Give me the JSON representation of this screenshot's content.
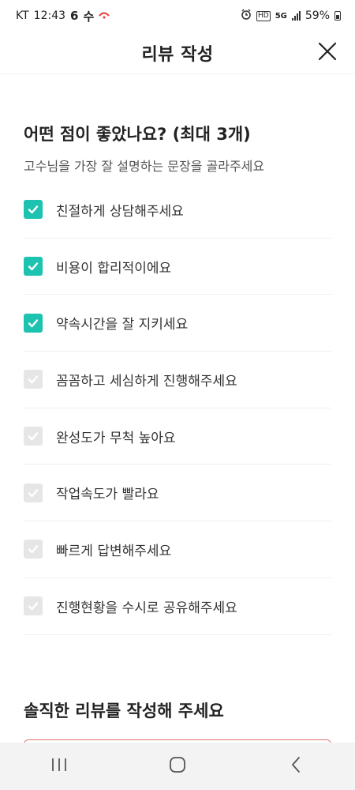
{
  "status_bar": {
    "carrier": "KT",
    "time": "12:43",
    "day": "6",
    "weekday": "수",
    "network": "5G",
    "hd": "HD",
    "battery": "59%"
  },
  "header": {
    "title": "리뷰 작성"
  },
  "question": {
    "title": "어떤 점이 좋았나요? (최대 3개)",
    "subtitle": "고수님을 가장 잘 설명하는 문장을 골라주세요",
    "options": [
      {
        "label": "친절하게 상담해주세요",
        "checked": true
      },
      {
        "label": "비용이 합리적이에요",
        "checked": true
      },
      {
        "label": "약속시간을 잘 지키세요",
        "checked": true
      },
      {
        "label": "꼼꼼하고 세심하게 진행해주세요",
        "checked": false
      },
      {
        "label": "완성도가 무척 높아요",
        "checked": false
      },
      {
        "label": "작업속도가 빨라요",
        "checked": false
      },
      {
        "label": "빠르게 답변해주세요",
        "checked": false
      },
      {
        "label": "진행현황을 수시로 공유해주세요",
        "checked": false
      }
    ]
  },
  "review": {
    "title": "솔직한 리뷰를 작성해 주세요"
  },
  "colors": {
    "accent": "#1dc3b0",
    "unchecked": "#e6e6e6",
    "textarea_border": "#e57373"
  }
}
